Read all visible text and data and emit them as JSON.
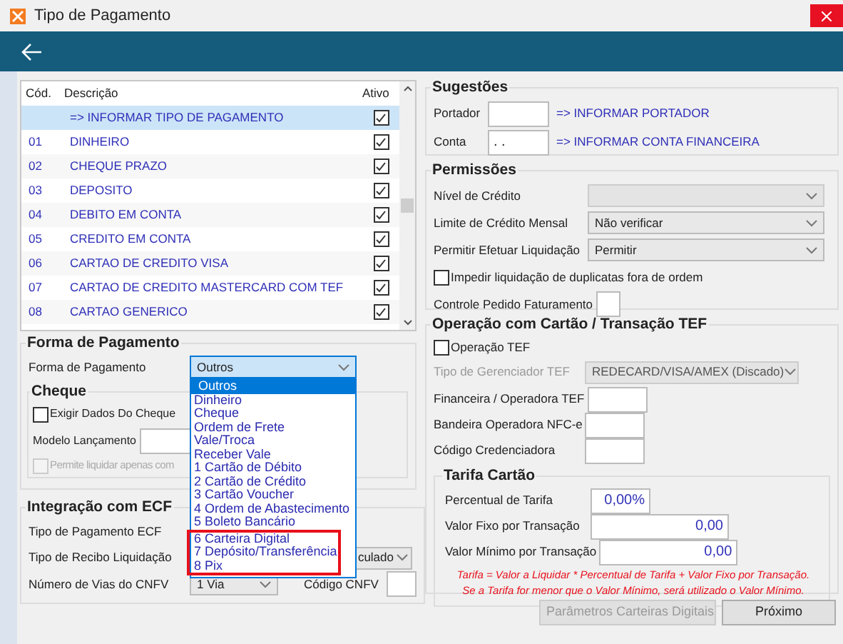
{
  "window": {
    "title": "Tipo de Pagamento"
  },
  "payment_types": {
    "columns": [
      "Cód.",
      "Descrição",
      "Ativo"
    ],
    "rows": [
      {
        "description": "=> INFORMAR TIPO DE PAGAMENTO",
        "active": true,
        "selected": true
      },
      {
        "code": "01",
        "description": "DINHEIRO",
        "active": true,
        "selected": false
      },
      {
        "code": "02",
        "description": "CHEQUE PRAZO",
        "active": true,
        "selected": false
      },
      {
        "code": "03",
        "description": "DEPOSITO",
        "active": true,
        "selected": false
      },
      {
        "code": "04",
        "description": "DEBITO EM CONTA",
        "active": true,
        "selected": false
      },
      {
        "code": "05",
        "description": "CREDITO EM CONTA",
        "active": true,
        "selected": false
      },
      {
        "code": "06",
        "description": "CARTAO DE CREDITO VISA",
        "active": true,
        "selected": false
      },
      {
        "code": "07",
        "description": "CARTAO DE CREDITO MASTERCARD COM TEF",
        "active": true,
        "selected": false
      },
      {
        "code": "08",
        "description": "CARTAO GENERICO",
        "active": true,
        "selected": false
      }
    ]
  },
  "forma_pagamento": {
    "title": "Forma de Pagamento",
    "label": "Forma de Pagamento",
    "value": "Outros",
    "options": [
      {
        "label": "Outros",
        "selected": true,
        "marked": false
      },
      {
        "label": "Dinheiro",
        "selected": false,
        "marked": false
      },
      {
        "label": "Cheque",
        "selected": false,
        "marked": false
      },
      {
        "label": "Ordem de Frete",
        "selected": false,
        "marked": false
      },
      {
        "label": "Vale/Troca",
        "selected": false,
        "marked": false
      },
      {
        "label": "Receber Vale",
        "selected": false,
        "marked": false
      },
      {
        "label": "1 Cartão de Débito",
        "selected": false,
        "marked": false
      },
      {
        "label": "2 Cartão de Crédito",
        "selected": false,
        "marked": false
      },
      {
        "label": "3 Cartão Voucher",
        "selected": false,
        "marked": false
      },
      {
        "label": "4 Ordem de Abastecimento",
        "selected": false,
        "marked": false
      },
      {
        "label": "5 Boleto Bancário",
        "selected": false,
        "marked": false
      },
      {
        "label": "6 Carteira Digital",
        "selected": false,
        "marked": true
      },
      {
        "label": "7 Depósito/Transferência",
        "selected": false,
        "marked": true
      },
      {
        "label": "8 Pix",
        "selected": false,
        "marked": true
      }
    ]
  },
  "cheque": {
    "title": "Cheque",
    "exigir": {
      "label": "Exigir Dados Do Cheque",
      "checked": false,
      "disabled": false
    },
    "modelo_label": "Modelo Lançamento",
    "permite": {
      "label": "Permite liquidar apenas com",
      "checked": false,
      "disabled": true
    }
  },
  "integracao": {
    "title": "Integração com ECF",
    "tipo_pagamento_label": "Tipo de Pagamento ECF",
    "tipo_recibo_label": "Tipo de Recibo Liquidação",
    "tipo_recibo_value": "culado",
    "vias_label": "Número de Vias do CNFV",
    "vias_value": "1 Via",
    "codigo_label": "Código CNFV"
  },
  "sugestoes": {
    "title": "Sugestões",
    "fields": [
      {
        "label": "Portador",
        "link": "=> INFORMAR PORTADOR"
      },
      {
        "label": "Conta",
        "value": ". .",
        "link": "=> INFORMAR CONTA FINANCEIRA"
      }
    ]
  },
  "permissoes": {
    "title": "Permissões",
    "selects": [
      {
        "label": "Nível de Crédito",
        "disabled": true
      },
      {
        "label": "Limite de Crédito Mensal",
        "value": "Não verificar",
        "disabled": false
      },
      {
        "label": "Permitir Efetuar Liquidação",
        "value": "Permitir",
        "disabled": false
      }
    ],
    "impedir": {
      "label": "Impedir liquidação de duplicatas fora de ordem",
      "checked": false
    },
    "controle_label": "Controle Pedido Faturamento"
  },
  "tef": {
    "title": "Operação com Cartão / Transação TEF",
    "operacao": {
      "label": "Operação TEF",
      "checked": false
    },
    "gerenciador": {
      "label": "Tipo de Gerenciador TEF",
      "value": "REDECARD/VISA/AMEX (Discado)",
      "disabled": true
    },
    "fields": [
      "Financeira / Operadora TEF",
      "Bandeira Operadora NFC-e",
      "Código Credenciadora"
    ]
  },
  "tarifa": {
    "title": "Tarifa Cartão",
    "fields": [
      {
        "label": "Percentual de Tarifa",
        "value": "0,00%",
        "kind": "short"
      },
      {
        "label": "Valor Fixo por Transação",
        "value": "0,00",
        "kind": "wide"
      },
      {
        "label": "Valor Mínimo por Transação",
        "value": "0,00",
        "kind": "wide"
      }
    ],
    "note": [
      "Tarifa = Valor a Liquidar *  Percentual de Tarifa + Valor Fixo por Transação.",
      "Se a Tarifa for menor que o Valor Mínimo, será utilizado o Valor Mínimo."
    ]
  },
  "buttons": [
    {
      "label": "Parâmetros Carteiras Digitais",
      "disabled": true
    },
    {
      "label": "Próximo",
      "disabled": false
    }
  ]
}
